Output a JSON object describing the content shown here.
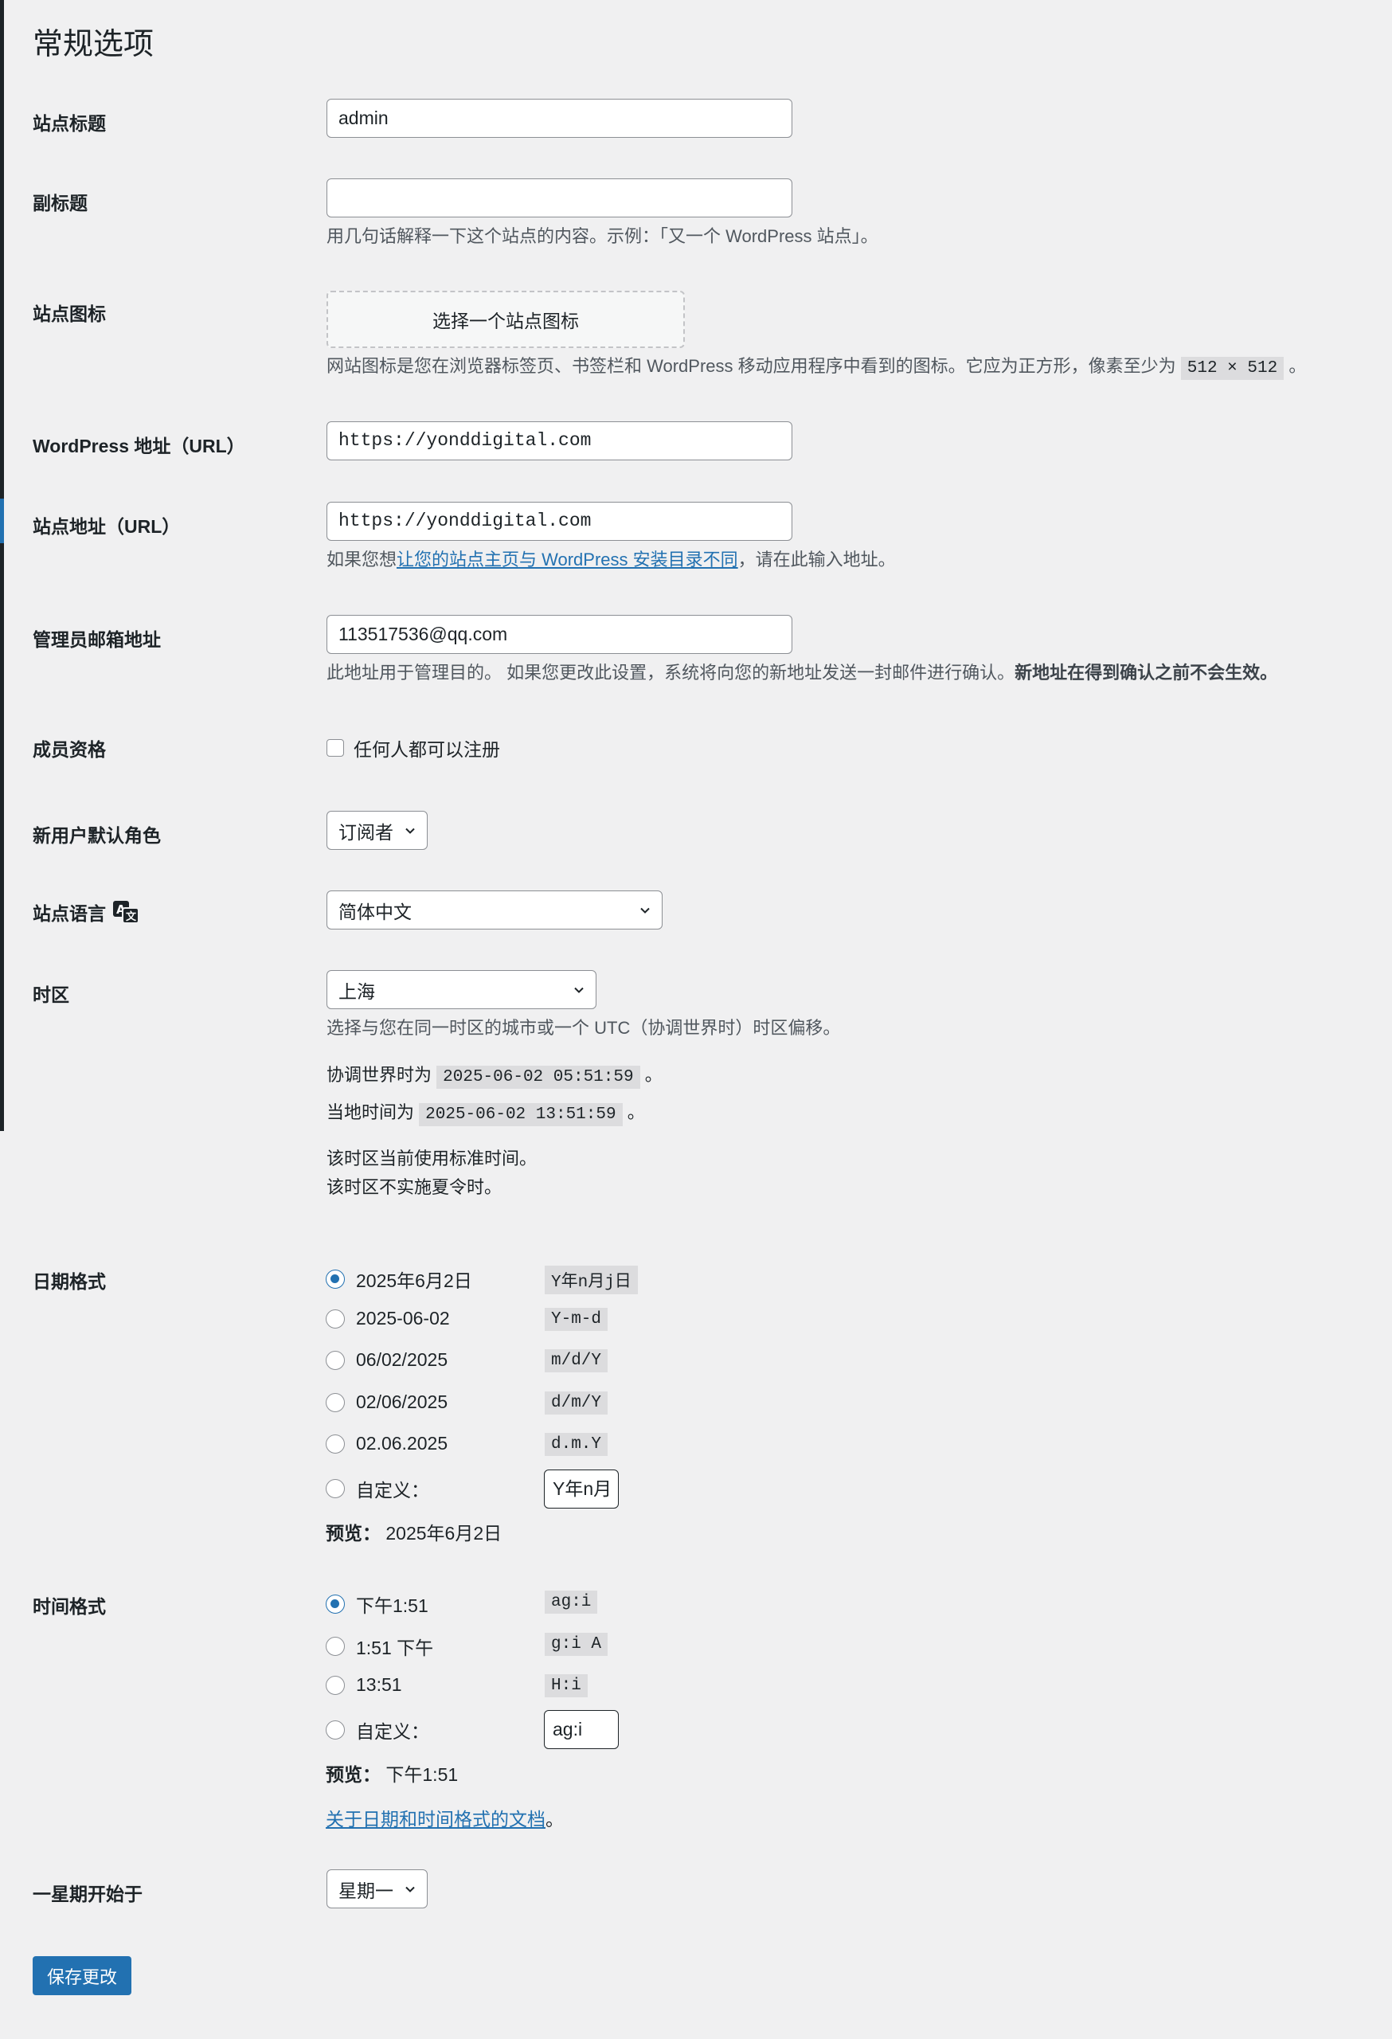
{
  "page": {
    "title": "常规选项"
  },
  "site_title": {
    "label": "站点标题",
    "value": "admin"
  },
  "tagline": {
    "label": "副标题",
    "value": "",
    "description": "用几句话解释一下这个站点的内容。示例：「又一个 WordPress 站点」。"
  },
  "site_icon": {
    "label": "站点图标",
    "button": "选择一个站点图标",
    "description": "网站图标是您在浏览器标签页、书签栏和 WordPress 移动应用程序中看到的图标。它应为正方形，像素至少为",
    "size_code": "512 × 512",
    "suffix": "。"
  },
  "wp_url": {
    "label": "WordPress 地址（URL）",
    "value": "https://yonddigital.com"
  },
  "site_url": {
    "label": "站点地址（URL）",
    "value": "https://yonddigital.com",
    "desc_prefix": "如果您想",
    "desc_link": "让您的站点主页与 WordPress 安装目录不同",
    "desc_suffix": "，请在此输入地址。"
  },
  "admin_email": {
    "label": "管理员邮箱地址",
    "value": "113517536@qq.com",
    "description": "此地址用于管理目的。 如果您更改此设置，系统将向您的新地址发送一封邮件进行确认。",
    "description_bold": "新地址在得到确认之前不会生效。"
  },
  "membership": {
    "label": "成员资格",
    "checkbox_label": "任何人都可以注册",
    "checked": false
  },
  "default_role": {
    "label": "新用户默认角色",
    "value": "订阅者"
  },
  "language": {
    "label": "站点语言",
    "value": "简体中文",
    "icon": "translate-icon"
  },
  "timezone": {
    "label": "时区",
    "value": "上海",
    "description": "选择与您在同一时区的城市或一个 UTC（协调世界时）时区偏移。",
    "utc_prefix": "协调世界时为",
    "utc_time": "2025-06-02 05:51:59",
    "local_prefix": "当地时间为",
    "local_time": "2025-06-02 13:51:59",
    "period": "。",
    "std_note": "该时区当前使用标准时间。",
    "dst_note": "该时区不实施夏令时。"
  },
  "date_format": {
    "label": "日期格式",
    "options": [
      {
        "label": "2025年6月2日",
        "code": "Y年n月j日",
        "checked": true
      },
      {
        "label": "2025-06-02",
        "code": "Y-m-d",
        "checked": false
      },
      {
        "label": "06/02/2025",
        "code": "m/d/Y",
        "checked": false
      },
      {
        "label": "02/06/2025",
        "code": "d/m/Y",
        "checked": false
      },
      {
        "label": "02.06.2025",
        "code": "d.m.Y",
        "checked": false
      }
    ],
    "custom_label": "自定义：",
    "custom_value": "Y年n月",
    "preview_label": "预览：",
    "preview_value": "2025年6月2日"
  },
  "time_format": {
    "label": "时间格式",
    "options": [
      {
        "label": "下午1:51",
        "code": "ag:i",
        "checked": true
      },
      {
        "label": "1:51 下午",
        "code": "g:i A",
        "checked": false
      },
      {
        "label": "13:51",
        "code": "H:i",
        "checked": false
      }
    ],
    "custom_label": "自定义：",
    "custom_value": "ag:i",
    "preview_label": "预览：",
    "preview_value": "下午1:51",
    "docs_link": "关于日期和时间格式的文档",
    "docs_suffix": "。"
  },
  "week_start": {
    "label": "一星期开始于",
    "value": "星期一"
  },
  "save_button": "保存更改",
  "colors": {
    "accent": "#2271b1",
    "background": "#f0f0f1",
    "text": "#1d2327"
  }
}
